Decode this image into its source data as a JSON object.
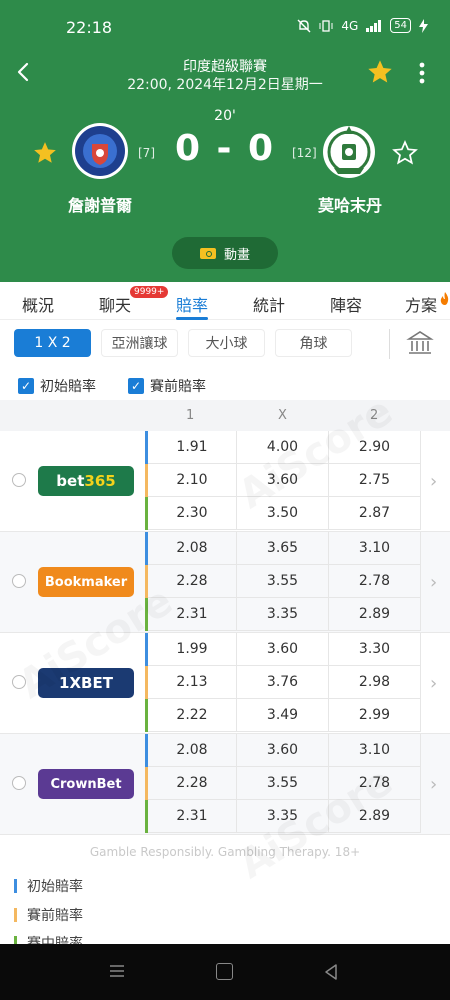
{
  "status_bar": {
    "time": "22:18",
    "signal": "4G",
    "battery": "54"
  },
  "match": {
    "league": "印度超級聯賽",
    "datetime": "22:00, 2024年12月2日星期一",
    "minute": "20'",
    "score": "0 - 0",
    "home": {
      "name": "詹謝普爾",
      "rank": "[7]"
    },
    "away": {
      "name": "莫哈末丹",
      "rank": "[12]"
    },
    "animation_label": "動畫"
  },
  "tabs": [
    {
      "label": "概況"
    },
    {
      "label": "聊天"
    },
    {
      "label": "賠率"
    },
    {
      "label": "統計"
    },
    {
      "label": "陣容"
    },
    {
      "label": "方案"
    }
  ],
  "chat_badge": "9999+",
  "filters": [
    {
      "label": "1 X 2"
    },
    {
      "label": "亞洲讓球"
    },
    {
      "label": "大小球"
    },
    {
      "label": "角球"
    }
  ],
  "checkboxes": [
    {
      "label": "初始賠率"
    },
    {
      "label": "賽前賠率"
    }
  ],
  "columns": [
    "1",
    "X",
    "2"
  ],
  "bookmakers": [
    {
      "name": "bet365",
      "color": "#1e7a4a",
      "accent": "#f4d21b",
      "rows": [
        [
          "1.91",
          "4.00",
          "2.90"
        ],
        [
          "2.10",
          "3.60",
          "2.75"
        ],
        [
          "2.30",
          "3.50",
          "2.87"
        ]
      ]
    },
    {
      "name": "Bookmaker",
      "color": "#f08a1c",
      "accent": "#ffffff",
      "rows": [
        [
          "2.08",
          "3.65",
          "3.10"
        ],
        [
          "2.28",
          "3.55",
          "2.78"
        ],
        [
          "2.31",
          "3.35",
          "2.89"
        ]
      ]
    },
    {
      "name": "1XBET",
      "color": "#1b3a72",
      "accent": "#ffffff",
      "rows": [
        [
          "1.99",
          "3.60",
          "3.30"
        ],
        [
          "2.13",
          "3.76",
          "2.98"
        ],
        [
          "2.22",
          "3.49",
          "2.99"
        ]
      ]
    },
    {
      "name": "CrownBet",
      "color": "#5b3a93",
      "accent": "#ffffff",
      "rows": [
        [
          "2.08",
          "3.60",
          "3.10"
        ],
        [
          "2.28",
          "3.55",
          "2.78"
        ],
        [
          "2.31",
          "3.35",
          "2.89"
        ]
      ]
    }
  ],
  "row_colors": {
    "initial": "#3d8ee0",
    "pre_match": "#f4b860",
    "live": "#6ab23f"
  },
  "gamble_note": "Gamble Responsibly. Gambling Therapy. 18+",
  "legend": [
    {
      "label": "初始賠率",
      "color": "#3d8ee0"
    },
    {
      "label": "賽前賠率",
      "color": "#f4b860"
    },
    {
      "label": "賽中賠率",
      "color": "#6ab23f"
    }
  ],
  "watermark_text": "AiScore",
  "colors": {
    "header_green": "#2e8b4a",
    "accent_blue": "#1a7dd6",
    "star": "#f4c021"
  }
}
